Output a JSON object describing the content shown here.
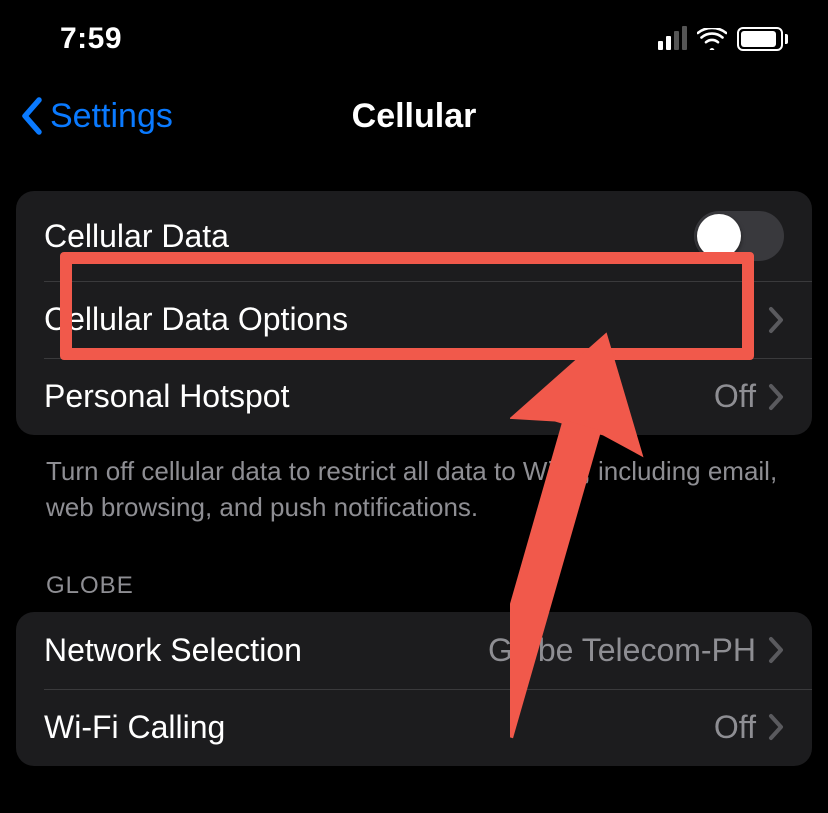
{
  "status": {
    "time": "7:59"
  },
  "nav": {
    "back_label": "Settings",
    "title": "Cellular"
  },
  "group1": {
    "cellular_data_label": "Cellular Data",
    "cellular_data_on": false,
    "data_options_label": "Cellular Data Options",
    "hotspot_label": "Personal Hotspot",
    "hotspot_value": "Off",
    "footer": "Turn off cellular data to restrict all data to Wi-Fi, including email, web browsing, and push notifications."
  },
  "section2": {
    "header": "GLOBE",
    "network_selection_label": "Network Selection",
    "network_selection_value": "Globe Telecom-PH",
    "wifi_calling_label": "Wi-Fi Calling",
    "wifi_calling_value": "Off"
  },
  "annotation": {
    "color": "#f1594b"
  }
}
